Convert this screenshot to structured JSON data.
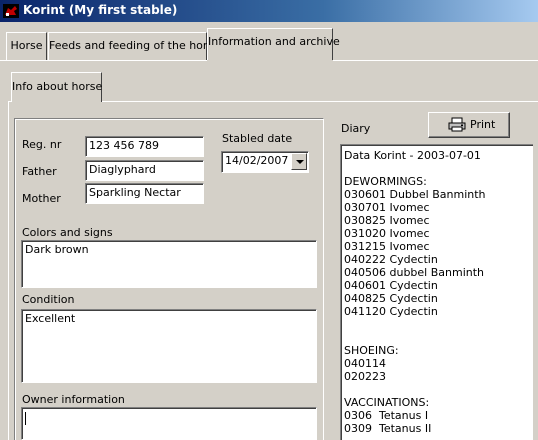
{
  "window": {
    "title": "Korint  (My first stable)"
  },
  "tabs": [
    {
      "label": "Horse"
    },
    {
      "label": "Feeds and feeding of the horse"
    },
    {
      "label": "Information and archive"
    }
  ],
  "subtab": {
    "label": "Info about horse"
  },
  "form": {
    "reg_label": "Reg. nr",
    "reg_value": "123 456 789",
    "father_label": "Father",
    "father_value": "Diaglyphard",
    "mother_label": "Mother",
    "mother_value": "Sparkling Nectar",
    "stabled_label": "Stabled date",
    "stabled_value": "14/02/2007",
    "colors_label": "Colors and signs",
    "colors_value": "Dark brown",
    "condition_label": "Condition",
    "condition_value": "Excellent",
    "owner_label": "Owner information",
    "owner_value": ""
  },
  "diary": {
    "label": "Diary",
    "print_label": "Print",
    "lines": [
      "Data Korint - 2003-07-01",
      "",
      "DEWORMINGS:",
      "030601 Dubbel Banminth",
      "030701 Ivomec",
      "030825 Ivomec",
      "031020 Ivomec",
      "031215 Ivomec",
      "040222 Cydectin",
      "040506 dubbel Banminth",
      "040601 Cydectin",
      "040825 Cydectin",
      "041120 Cydectin",
      "",
      "",
      "SHOEING:",
      "040114",
      "020223",
      "",
      "VACCINATIONS:",
      "0306  Tetanus I",
      "0309  Tetanus II"
    ]
  },
  "icons": {
    "app": "horse-stable-icon",
    "printer": "printer-icon",
    "dropdown": "chevron-down-icon"
  },
  "colors": {
    "titlebar_start": "#0a246a",
    "titlebar_end": "#a6caf0",
    "face": "#d4d0c8"
  }
}
